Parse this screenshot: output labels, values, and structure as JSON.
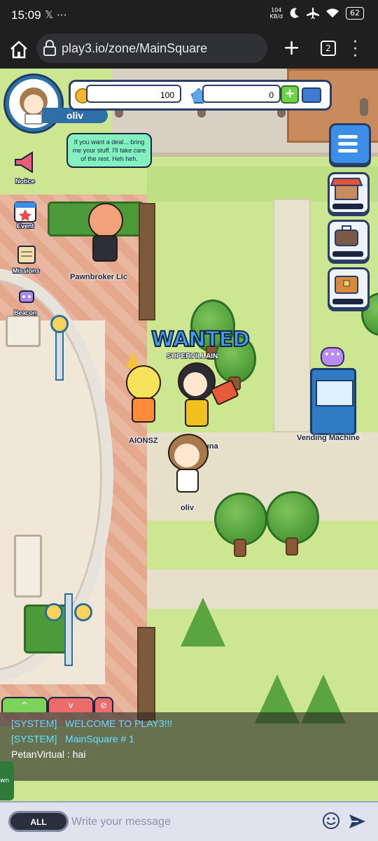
{
  "status_bar": {
    "time": "15:09",
    "notif_icons": "𝕏  ⋯",
    "net_speed_value": "104",
    "net_speed_unit": "KB/d",
    "battery": "62"
  },
  "browser": {
    "url": "play3.io/zone/MainSquare",
    "tab_count": "2"
  },
  "hud": {
    "player_name": "oliv",
    "coins": "100",
    "gems": "0"
  },
  "left_menu": {
    "items": [
      {
        "label": "Notice",
        "icon": "megaphone-icon"
      },
      {
        "label": "Event",
        "icon": "calendar-star-icon"
      },
      {
        "label": "Missions",
        "icon": "scroll-icon"
      },
      {
        "label": "Beacon",
        "icon": "robot-icon"
      }
    ]
  },
  "right_menu": {
    "items": [
      {
        "icon": "menu-icon"
      },
      {
        "icon": "shop-icon",
        "label": "Shop"
      },
      {
        "icon": "bag-icon",
        "label": "Bag"
      },
      {
        "icon": "chest-icon",
        "label": "Rewards"
      }
    ]
  },
  "npc": {
    "speech": "If you want a deal... bring me your stuff. I'll take care of the rest. Heh heh.",
    "name": "Pawnbroker Lic"
  },
  "banner": {
    "title": "WANTED",
    "subtitle": "SUPERVILLAIN"
  },
  "characters": {
    "party_name": "AIONSZ",
    "hammer_name": "una",
    "player_name": "oliv"
  },
  "vending": {
    "label": "Vending Machine",
    "bubble": "•••"
  },
  "chat": {
    "tabs": [
      "^",
      "v",
      "⊘"
    ],
    "lines": [
      {
        "tag": "[SYSTEM]",
        "text": "WELCOME TO PLAY3!!!"
      },
      {
        "tag": "[SYSTEM]",
        "text": "MainSquare # 1"
      }
    ],
    "user_line": {
      "user": "PetanVirtual",
      "sep": " : ",
      "text": "hai"
    },
    "side_tab": "wn",
    "channel_button": "ALL",
    "input_placeholder": "Write your message"
  },
  "colors": {
    "hud_blue": "#2f6fa8",
    "system_text": "#5ee3ff",
    "speech_bubble": "#82f0bf",
    "grass": "#cde691"
  }
}
